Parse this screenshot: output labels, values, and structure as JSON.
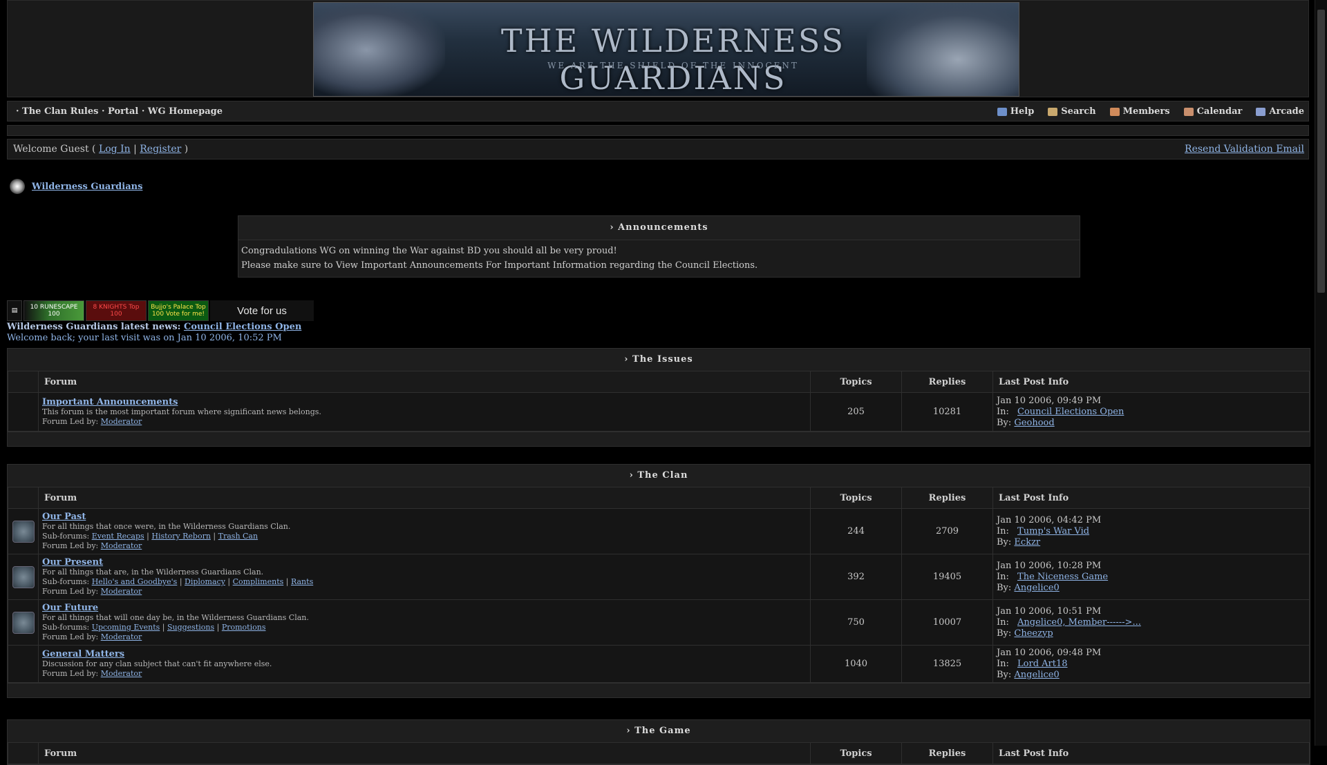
{
  "banner": {
    "title": "THE WILDERNESS GUARDIANS",
    "motto": "WE ARE THE SHIELD OF THE INNOCENT"
  },
  "nav": {
    "left": "· The Clan Rules · Portal · WG Homepage",
    "right": [
      {
        "label": "Help",
        "icon": "help-icon",
        "color": "#6d8fc9"
      },
      {
        "label": "Search",
        "icon": "search-icon",
        "color": "#c9a86d"
      },
      {
        "label": "Members",
        "icon": "members-icon",
        "color": "#d08a5a"
      },
      {
        "label": "Calendar",
        "icon": "calendar-icon",
        "color": "#c98f6d"
      },
      {
        "label": "Arcade",
        "icon": "arcade-icon",
        "color": "#8a9ed0"
      }
    ]
  },
  "welcome": {
    "prefix": "Welcome Guest ( ",
    "login": "Log In",
    "sep": " | ",
    "register": "Register",
    "suffix": " )",
    "resend": "Resend Validation Email"
  },
  "breadcrumb": "Wilderness Guardians",
  "announcements": {
    "title": "Announcements",
    "lines": [
      "Congradulations WG on winning the War against BD you should all be very proud!",
      " Please make sure to View Important Announcements For Important Information regarding the Council Elections."
    ]
  },
  "vote": {
    "label": "Vote for us",
    "buttons": [
      "10 RUNESCAPE 100",
      "8 KNIGHTS Top 100",
      "Bujjo's Palace Top 100 Vote for me!"
    ]
  },
  "news": {
    "prefix": "Wilderness Guardians latest news: ",
    "link": "Council Elections Open",
    "last_visit": "Welcome back; your last visit was on Jan 10 2006, 10:52 PM"
  },
  "headers": {
    "forum": "Forum",
    "topics": "Topics",
    "replies": "Replies",
    "last": "Last Post Info"
  },
  "categories": [
    {
      "title": "The Issues",
      "forums": [
        {
          "name": "Important Announcements",
          "desc": "This forum is the most important forum where significant news belongs.",
          "subforums": [],
          "led_label": "Forum Led by: ",
          "led_by": "Moderator",
          "topics": "205",
          "replies": "10281",
          "last_date": "Jan 10 2006, 09:49 PM",
          "in_label": "In:",
          "in_topic": "Council Elections Open",
          "by_label": "By:",
          "by_user": "Geohood",
          "icon": false
        }
      ]
    },
    {
      "title": "The Clan",
      "forums": [
        {
          "name": "Our Past",
          "desc": "For all things that once were, in the Wilderness Guardians Clan.",
          "sub_label": "Sub-forums: ",
          "subforums": [
            "Event Recaps",
            "History Reborn",
            "Trash Can"
          ],
          "led_label": "Forum Led by: ",
          "led_by": "Moderator",
          "topics": "244",
          "replies": "2709",
          "last_date": "Jan 10 2006, 04:42 PM",
          "in_label": "In:",
          "in_topic": "Tump's War Vid",
          "by_label": "By:",
          "by_user": "Eckzr",
          "icon": true
        },
        {
          "name": "Our Present",
          "desc": "For all things that are, in the Wilderness Guardians Clan.",
          "sub_label": "Sub-forums: ",
          "subforums": [
            "Hello's and Goodbye's",
            "Diplomacy",
            "Compliments",
            "Rants"
          ],
          "led_label": "Forum Led by: ",
          "led_by": "Moderator",
          "topics": "392",
          "replies": "19405",
          "last_date": "Jan 10 2006, 10:28 PM",
          "in_label": "In:",
          "in_topic": "The Niceness Game",
          "by_label": "By:",
          "by_user": "Angelice0",
          "icon": true
        },
        {
          "name": "Our Future",
          "desc": "For all things that will one day be, in the Wilderness Guardians Clan.",
          "sub_label": "Sub-forums: ",
          "subforums": [
            "Upcoming Events",
            "Suggestions",
            "Promotions"
          ],
          "led_label": "Forum Led by: ",
          "led_by": "Moderator",
          "topics": "750",
          "replies": "10007",
          "last_date": "Jan 10 2006, 10:51 PM",
          "in_label": "In:",
          "in_topic": "Angelice0, Member------>...",
          "by_label": "By:",
          "by_user": "Cheezyp",
          "icon": true
        },
        {
          "name": "General Matters",
          "desc": "Discussion for any clan subject that can't fit anywhere else.",
          "subforums": [],
          "led_label": "Forum Led by: ",
          "led_by": "Moderator",
          "topics": "1040",
          "replies": "13825",
          "last_date": "Jan 10 2006, 09:48 PM",
          "in_label": "In:",
          "in_topic": "Lord Art18",
          "by_label": "By:",
          "by_user": "Angelice0",
          "icon": false
        }
      ]
    },
    {
      "title": "The Game",
      "forums": []
    }
  ]
}
